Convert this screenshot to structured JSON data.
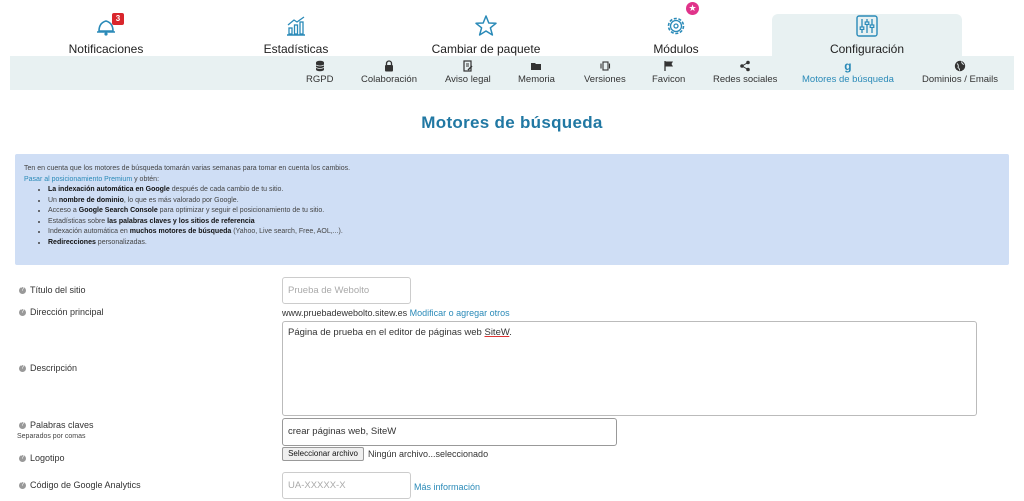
{
  "topnav": {
    "items": [
      {
        "label": "Notificaciones",
        "badge": "3"
      },
      {
        "label": "Estadísticas"
      },
      {
        "label": "Cambiar de paquete"
      },
      {
        "label": "Módulos"
      },
      {
        "label": "Configuración"
      }
    ]
  },
  "subnav": {
    "items": [
      {
        "label": "RGPD"
      },
      {
        "label": "Colaboración"
      },
      {
        "label": "Aviso legal"
      },
      {
        "label": "Memoria"
      },
      {
        "label": "Versiones"
      },
      {
        "label": "Favicon"
      },
      {
        "label": "Redes sociales"
      },
      {
        "label": "Motores de búsqueda"
      },
      {
        "label": "Dominios / Emails"
      }
    ],
    "active": "Motores de búsqueda"
  },
  "page": {
    "title": "Motores de búsqueda"
  },
  "info": {
    "intro": "Ten en cuenta que los motores de búsqueda tomarán varias semanas para tomar en cuenta los cambios.",
    "premium_link": "Pasar al posicionamiento Premium",
    "premium_tail": " y obtén:",
    "bullets": [
      {
        "pre": "",
        "bold": "La indexación automática en Google",
        "post": " después de cada cambio de tu sitio."
      },
      {
        "pre": "Un ",
        "bold": "nombre de dominio",
        "post": ", lo que es más valorado por Google."
      },
      {
        "pre": "Acceso a ",
        "bold": "Google Search Console",
        "post": " para optimizar y seguir el posicionamiento de tu sitio."
      },
      {
        "pre": "Estadísticas sobre ",
        "bold": "las palabras claves y los sitios de referencia",
        "post": ""
      },
      {
        "pre": "Indexación automática en ",
        "bold": "muchos motores de búsqueda",
        "post": " (Yahoo, Live search, Free, AOL,...)."
      },
      {
        "pre": "",
        "bold": "Redirecciones",
        "post": " personalizadas."
      }
    ]
  },
  "form": {
    "site_title": {
      "label": "Título del sitio",
      "placeholder": "Prueba de Webolto"
    },
    "main_address": {
      "label": "Dirección principal",
      "value": "www.pruebadewebolto.sitew.es",
      "link": "Modificar o agregar otros"
    },
    "description": {
      "label": "Descripción",
      "value_pre": "Página de prueba en el editor de páginas web ",
      "value_brand": "SiteW",
      "value_post": "."
    },
    "keywords": {
      "label": "Palabras claves",
      "sublabel": "Separados por comas",
      "value": "crear páginas web, SiteW"
    },
    "logo": {
      "label": "Logotipo",
      "button": "Seleccionar archivo",
      "status": "Ningún archivo...seleccionado"
    },
    "analytics": {
      "label": "Código de Google Analytics",
      "placeholder": "UA-XXXXX-X",
      "link": "Más información"
    }
  },
  "colors": {
    "accent": "#2a8ab8",
    "title": "#2178a3",
    "info_bg": "#cfdef5",
    "subnav_bg": "#e8f1f2",
    "badge": "#d9262c",
    "favicon_star": "#e0338a"
  }
}
